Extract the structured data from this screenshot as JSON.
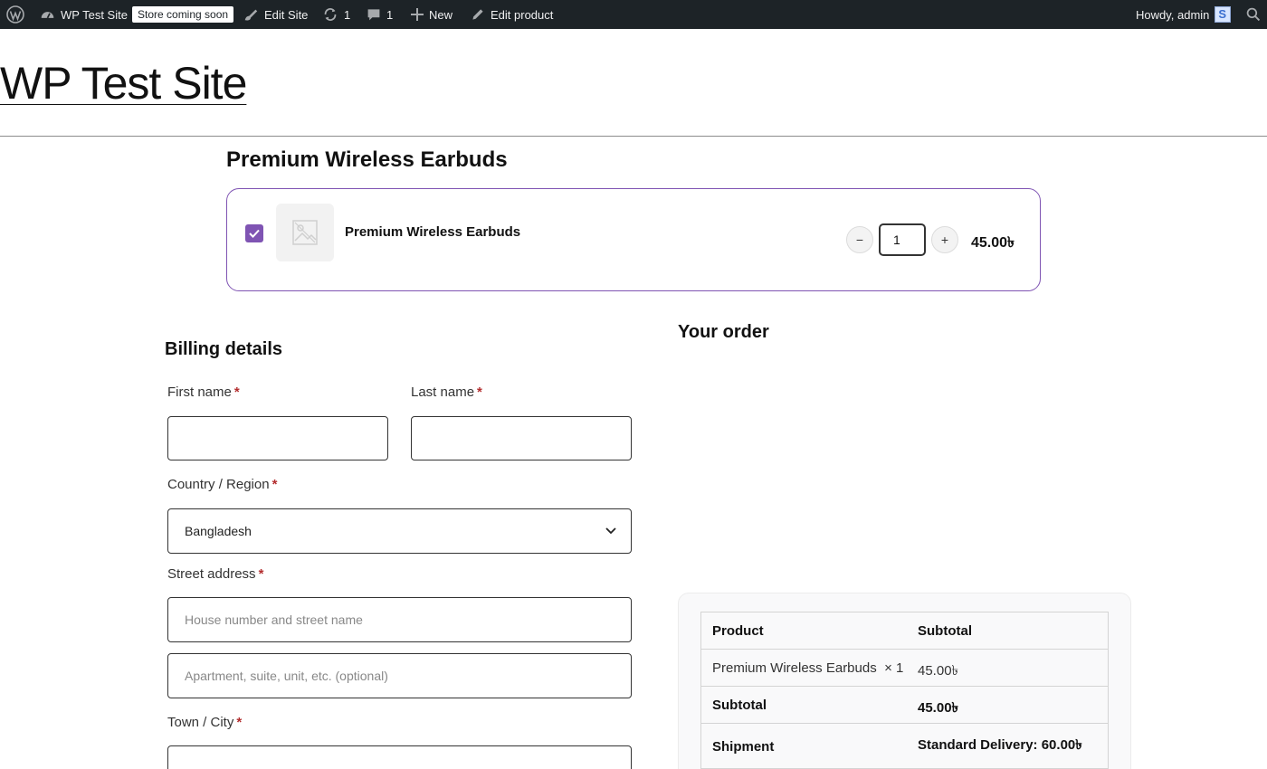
{
  "adminbar": {
    "site_name": "WP Test Site",
    "store_badge": "Store coming soon",
    "edit_site": "Edit Site",
    "updates_count": "1",
    "comments_count": "1",
    "new_label": "New",
    "edit_product": "Edit product",
    "howdy": "Howdy, admin"
  },
  "site": {
    "title": "WP Test Site"
  },
  "product": {
    "heading": "Premium Wireless Earbuds",
    "name": "Premium Wireless Earbuds",
    "quantity": "1",
    "price": "45.00৳",
    "minus_label": "−",
    "plus_label": "+"
  },
  "billing": {
    "heading": "Billing details",
    "first_name_label": "First name",
    "last_name_label": "Last name",
    "country_label": "Country / Region",
    "country_value": "Bangladesh",
    "street_label": "Street address",
    "street_placeholder": "House number and street name",
    "apartment_placeholder": "Apartment, suite, unit, etc. (optional)",
    "city_label": "Town / City",
    "required_mark": "*"
  },
  "order": {
    "heading": "Your order",
    "col_product": "Product",
    "col_subtotal": "Subtotal",
    "line_item": "Premium Wireless Earbuds",
    "line_qty": "× 1",
    "line_total": "45.00৳",
    "subtotal_label": "Subtotal",
    "subtotal_value": "45.00৳",
    "shipment_label": "Shipment",
    "shipment_value": "Standard Delivery: 60.00৳"
  },
  "colors": {
    "adminbar_bg": "#1d2327",
    "accent": "#7f54b3",
    "required": "#b32d2e"
  }
}
